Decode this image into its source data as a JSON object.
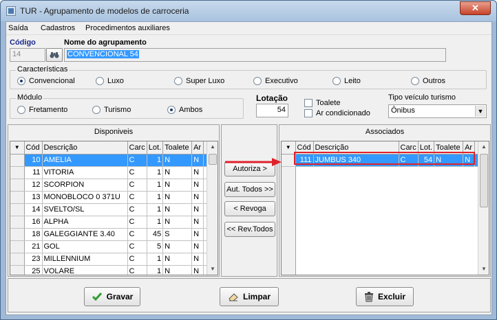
{
  "window": {
    "title": "TUR - Agrupamento de modelos de carroceria",
    "close_glyph": "✕"
  },
  "menu": [
    "Saída",
    "Cadastros",
    "Procedimentos auxiliares"
  ],
  "form": {
    "codigo_label": "Código",
    "codigo_value": "14",
    "nome_label": "Nome do agrupamento",
    "nome_value": "CONVENCIONAL 54"
  },
  "caracteristicas": {
    "title": "Características",
    "options": [
      "Convencional",
      "Luxo",
      "Super Luxo",
      "Executivo",
      "Leito",
      "Outros"
    ],
    "selected": "Convencional"
  },
  "modulo": {
    "title": "Módulo",
    "options": [
      "Fretamento",
      "Turismo",
      "Ambos"
    ],
    "selected": "Ambos"
  },
  "lotacao": {
    "label": "Lotação",
    "value": "54"
  },
  "checks": [
    {
      "label": "Toalete",
      "checked": false
    },
    {
      "label": "Ar condicionado",
      "checked": false
    }
  ],
  "tipo_veiculo": {
    "label": "Tipo veículo turismo",
    "value": "Ônibus"
  },
  "disponiveis": {
    "title": "Disponiveis",
    "columns": [
      "Cód",
      "Descrição",
      "Carc",
      "Lot.",
      "Toalete",
      "Ar"
    ],
    "rows": [
      [
        "10",
        "AMELIA",
        "C",
        "1",
        "N",
        "N"
      ],
      [
        "11",
        "VITORIA",
        "C",
        "1",
        "N",
        "N"
      ],
      [
        "12",
        "SCORPION",
        "C",
        "1",
        "N",
        "N"
      ],
      [
        "13",
        "MONOBLOCO 0 371U",
        "C",
        "1",
        "N",
        "N"
      ],
      [
        "14",
        "SVELTO/SL",
        "C",
        "1",
        "N",
        "N"
      ],
      [
        "16",
        "ALPHA",
        "C",
        "1",
        "N",
        "N"
      ],
      [
        "18",
        "GALEGGIANTE 3.40",
        "C",
        "45",
        "S",
        "N"
      ],
      [
        "21",
        "GOL",
        "C",
        "5",
        "N",
        "N"
      ],
      [
        "23",
        "MILLENNIUM",
        "C",
        "1",
        "N",
        "N"
      ],
      [
        "25",
        "VOLARE",
        "C",
        "1",
        "N",
        "N"
      ]
    ],
    "selected_index": 0
  },
  "associados": {
    "title": "Associados",
    "columns": [
      "Cód",
      "Descrição",
      "Carc",
      "Lot.",
      "Toalete",
      "Ar"
    ],
    "rows": [
      [
        "111",
        "JUMBUS 340",
        "C",
        "54",
        "N",
        "N"
      ]
    ],
    "selected_index": 0
  },
  "transfer_buttons": {
    "autoriza": "Autoriza >",
    "aut_todos": "Aut. Todos >>",
    "revoga": "< Revoga",
    "rev_todos": "<< Rev.Todos"
  },
  "actions": {
    "gravar": "Gravar",
    "limpar": "Limpar",
    "excluir": "Excluir"
  },
  "colors": {
    "selection": "#3399ff",
    "highlight": "#e0202a",
    "gravar_check": "#2e9c2e"
  }
}
